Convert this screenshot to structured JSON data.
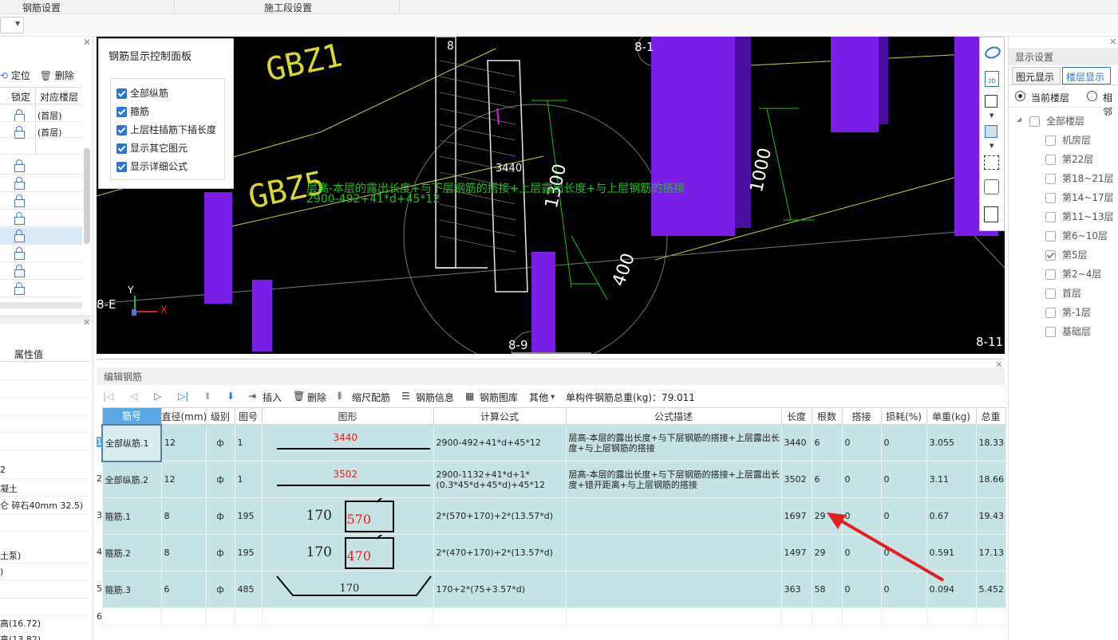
{
  "topbar": {
    "tab1": "钢筋设置",
    "tab2": "施工段设置"
  },
  "left_panel": {
    "locate": "定位",
    "delete": "删除",
    "col_lock": "锁定",
    "col_floor": "对应楼层",
    "floor_rows": [
      "(首层)",
      "(首层)"
    ],
    "prop_header": "属性值",
    "prop_values": [
      "2",
      "凝土",
      "仑 碎石40mm 32.5)",
      "土泵)",
      ")",
      "高(16.72)",
      "高(13.82)"
    ]
  },
  "control_panel": {
    "title": "钢筋显示控制面板",
    "items": [
      "全部纵筋",
      "箍筋",
      "上层柱插筋下插长度",
      "显示其它图元",
      "显示详细公式"
    ]
  },
  "viewport": {
    "labels": [
      "GBZ1",
      "GBZ5",
      "8",
      "8-1",
      "8-E",
      "8-9",
      "8-11",
      "3440",
      "1300",
      "1000",
      "400"
    ],
    "formula1": "层高-本层的露出长度+与下层钢筋的搭接+上层露出长度+与上层钢筋的搭接",
    "formula2": "2900-492+41*d+45*12",
    "axis_y": "Y",
    "axis_x": "X"
  },
  "right_panel": {
    "title": "显示设置",
    "tab1": "图元显示",
    "tab2": "楼层显示",
    "radio1": "当前楼层",
    "radio2": "相邻",
    "floors": [
      {
        "label": "全部楼层",
        "checked": false
      },
      {
        "label": "机房层",
        "checked": false
      },
      {
        "label": "第22层",
        "checked": false
      },
      {
        "label": "第18~21层",
        "checked": false
      },
      {
        "label": "第14~17层",
        "checked": false
      },
      {
        "label": "第11~13层",
        "checked": false
      },
      {
        "label": "第6~10层",
        "checked": false
      },
      {
        "label": "第5层",
        "checked": true
      },
      {
        "label": "第2~4层",
        "checked": false
      },
      {
        "label": "首层",
        "checked": false
      },
      {
        "label": "第-1层",
        "checked": false
      },
      {
        "label": "基础层",
        "checked": false
      }
    ]
  },
  "editor": {
    "title": "编辑钢筋",
    "toolbar": {
      "insert": "插入",
      "delete": "删除",
      "scale": "缩尺配筋",
      "info": "钢筋信息",
      "lib": "钢筋图库",
      "other": "其他",
      "total": "单构件钢筋总重(kg)：79.011"
    },
    "headers": [
      "筋号",
      "直径(mm)",
      "级别",
      "图号",
      "图形",
      "计算公式",
      "公式描述",
      "长度",
      "根数",
      "搭接",
      "损耗(%)",
      "单重(kg)",
      "总重"
    ],
    "rows": [
      {
        "num": "1",
        "name": "全部纵筋.1",
        "dia": "12",
        "grade": "ф",
        "fig": "1",
        "shape": "3440",
        "formula": "2900-492+41*d+45*12",
        "desc": "层高-本层的露出长度+与下层钢筋的搭接+上层露出长度+与上层钢筋的搭接",
        "len": "3440",
        "count": "6",
        "lap": "0",
        "loss": "0",
        "unit": "3.055",
        "total": "18.33"
      },
      {
        "num": "2",
        "name": "全部纵筋.2",
        "dia": "12",
        "grade": "ф",
        "fig": "1",
        "shape": "3502",
        "formula": "2900-1132+41*d+1*(0.3*45*d+45*d)+45*12",
        "desc": "层高-本层的露出长度+与下层钢筋的搭接+上层露出长度+错开距离+与上层钢筋的搭接",
        "len": "3502",
        "count": "6",
        "lap": "0",
        "loss": "0",
        "unit": "3.11",
        "total": "18.66"
      },
      {
        "num": "3",
        "name": "箍筋.1",
        "dia": "8",
        "grade": "ф",
        "fig": "195",
        "shape_a": "170",
        "shape_b": "570",
        "formula": "2*(570+170)+2*(13.57*d)",
        "desc": "",
        "len": "1697",
        "count": "29",
        "lap": "0",
        "loss": "0",
        "unit": "0.67",
        "total": "19.43"
      },
      {
        "num": "4",
        "name": "箍筋.2",
        "dia": "8",
        "grade": "ф",
        "fig": "195",
        "shape_a": "170",
        "shape_b": "470",
        "formula": "2*(470+170)+2*(13.57*d)",
        "desc": "",
        "len": "1497",
        "count": "29",
        "lap": "0",
        "loss": "0",
        "unit": "0.591",
        "total": "17.13"
      },
      {
        "num": "5",
        "name": "箍筋.3",
        "dia": "6",
        "grade": "ф",
        "fig": "485",
        "shape": "170",
        "formula": "170+2*(75+3.57*d)",
        "desc": "",
        "len": "363",
        "count": "58",
        "lap": "0",
        "loss": "0",
        "unit": "0.094",
        "total": "5.452"
      }
    ],
    "empty_row_num": "6"
  }
}
